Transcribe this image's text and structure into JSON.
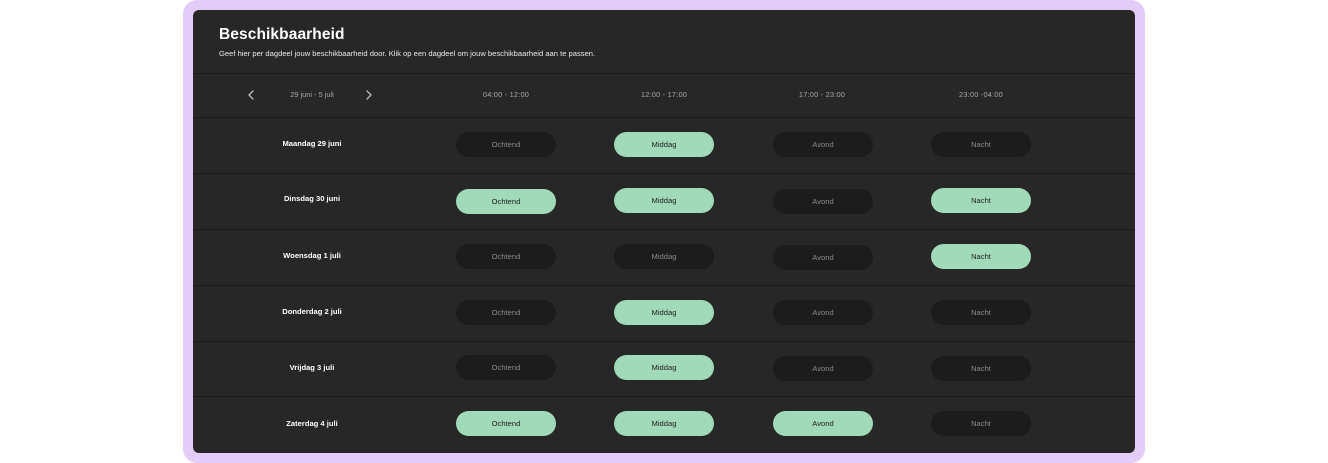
{
  "page": {
    "title": "Beschikbaarheid",
    "subtitle": "Geef hier per dagdeel jouw beschikbaarheid door. Klik op een dagdeel om jouw beschikbaarheid aan te passen."
  },
  "week": {
    "range_label": "29 juni - 5 juli",
    "prev_icon": "chevron-left-icon",
    "next_icon": "chevron-right-icon"
  },
  "slots": [
    {
      "time": "04:00 - 12:00",
      "label": "Ochtend"
    },
    {
      "time": "12:00 - 17:00",
      "label": "Middag"
    },
    {
      "time": "17:00 - 23:00",
      "label": "Avond"
    },
    {
      "time": "23:00 -04:00",
      "label": "Nacht"
    }
  ],
  "days": [
    {
      "label": "Maandag 29 juni",
      "availability": [
        false,
        true,
        false,
        false
      ]
    },
    {
      "label": "Dinsdag 30 juni",
      "availability": [
        true,
        true,
        false,
        true
      ]
    },
    {
      "label": "Woensdag 1 juli",
      "availability": [
        false,
        false,
        false,
        true
      ]
    },
    {
      "label": "Donderdag 2 juli",
      "availability": [
        false,
        true,
        false,
        false
      ]
    },
    {
      "label": "Vrijdag  3 juli",
      "availability": [
        false,
        true,
        false,
        false
      ]
    },
    {
      "label": "Zaterdag 4 juli",
      "availability": [
        true,
        true,
        true,
        false
      ]
    }
  ],
  "colors": {
    "frame": "#e3ccf8",
    "card": "#272727",
    "available": "#a1dab9",
    "unavailable": "#1c1c1c"
  }
}
